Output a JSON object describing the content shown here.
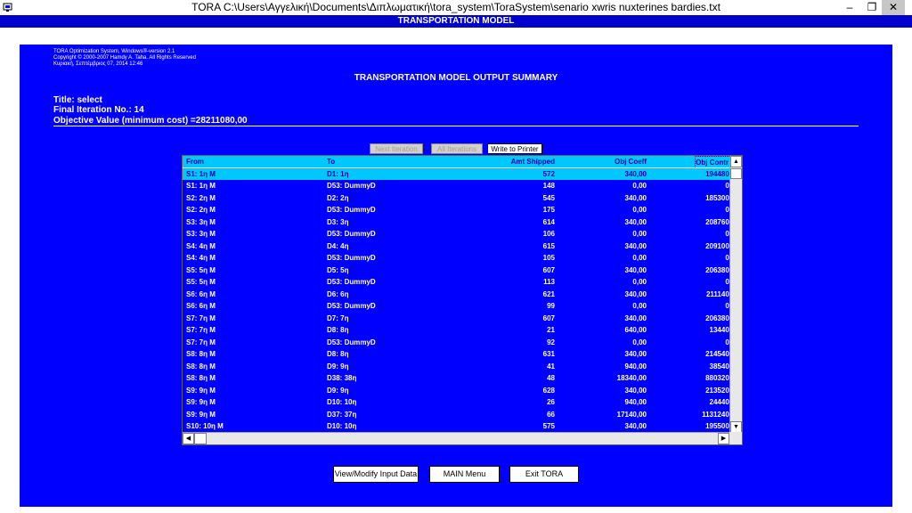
{
  "window": {
    "title": "TORA  C:\\Users\\Αγγελική\\Documents\\Διπλωματική\\tora_system\\ToraSystem\\senario xwris nuxterines bardies.txt",
    "min_glyph": "–",
    "max_glyph": "❐",
    "close_glyph": "✕"
  },
  "frame_caption": "TRANSPORTATION MODEL",
  "copyright": {
    "line1": "TORA Optimization System, Windows®-version 2.1",
    "line2": "Copyright © 2000-2007 Hamdy A. Taha.  All Rights Reserved",
    "line3": "Κυριακή, Σεπτέμβριος 07, 2014 12:46"
  },
  "summary": {
    "heading": "TRANSPORTATION MODEL OUTPUT SUMMARY",
    "title_line": "Title: select",
    "iteration_line": "Final Iteration No.:  14",
    "objective_line": "Objective Value (minimum cost) =28211080,00"
  },
  "toolbar": {
    "next_iteration": "Next Iteration",
    "all_iterations": "All Iterations",
    "write_to_printer": "Write to Printer"
  },
  "table": {
    "headers": {
      "from": "From",
      "to": "To",
      "amt": "Amt Shipped",
      "coeff": "Obj Coeff",
      "contr": "Obj Contr"
    },
    "rows": [
      {
        "from": "S1:  1η M",
        "to": "D1:  1η",
        "amt": "572",
        "coeff": "340,00",
        "contr": "194480,"
      },
      {
        "from": "S1:  1η M",
        "to": "D53:  DummyD",
        "amt": "148",
        "coeff": "0,00",
        "contr": "0,"
      },
      {
        "from": "S2:  2η M",
        "to": "D2:  2η",
        "amt": "545",
        "coeff": "340,00",
        "contr": "185300,"
      },
      {
        "from": "S2:  2η M",
        "to": "D53:  DummyD",
        "amt": "175",
        "coeff": "0,00",
        "contr": "0,"
      },
      {
        "from": "S3:  3η M",
        "to": "D3:  3η",
        "amt": "614",
        "coeff": "340,00",
        "contr": "208760,"
      },
      {
        "from": "S3:  3η M",
        "to": "D53:  DummyD",
        "amt": "106",
        "coeff": "0,00",
        "contr": "0,"
      },
      {
        "from": "S4:  4η M",
        "to": "D4:  4η",
        "amt": "615",
        "coeff": "340,00",
        "contr": "209100,"
      },
      {
        "from": "S4:  4η M",
        "to": "D53:  DummyD",
        "amt": "105",
        "coeff": "0,00",
        "contr": "0,"
      },
      {
        "from": "S5:  5η M",
        "to": "D5:  5η",
        "amt": "607",
        "coeff": "340,00",
        "contr": "206380,"
      },
      {
        "from": "S5:  5η M",
        "to": "D53:  DummyD",
        "amt": "113",
        "coeff": "0,00",
        "contr": "0,"
      },
      {
        "from": "S6:  6η M",
        "to": "D6:  6η",
        "amt": "621",
        "coeff": "340,00",
        "contr": "211140,"
      },
      {
        "from": "S6:  6η M",
        "to": "D53:  DummyD",
        "amt": "99",
        "coeff": "0,00",
        "contr": "0,"
      },
      {
        "from": "S7:  7η M",
        "to": "D7:  7η",
        "amt": "607",
        "coeff": "340,00",
        "contr": "206380,"
      },
      {
        "from": "S7:  7η M",
        "to": "D8:  8η",
        "amt": "21",
        "coeff": "640,00",
        "contr": "13440,"
      },
      {
        "from": "S7:  7η M",
        "to": "D53:  DummyD",
        "amt": "92",
        "coeff": "0,00",
        "contr": "0,"
      },
      {
        "from": "S8:  8η M",
        "to": "D8:  8η",
        "amt": "631",
        "coeff": "340,00",
        "contr": "214540,"
      },
      {
        "from": "S8:  8η M",
        "to": "D9:  9η",
        "amt": "41",
        "coeff": "940,00",
        "contr": "38540,"
      },
      {
        "from": "S8:  8η M",
        "to": "D38:  38η",
        "amt": "48",
        "coeff": "18340,00",
        "contr": "880320,"
      },
      {
        "from": "S9:  9η M",
        "to": "D9:  9η",
        "amt": "628",
        "coeff": "340,00",
        "contr": "213520,"
      },
      {
        "from": "S9:  9η M",
        "to": "D10:  10η",
        "amt": "26",
        "coeff": "940,00",
        "contr": "24440,"
      },
      {
        "from": "S9:  9η M",
        "to": "D37:  37η",
        "amt": "66",
        "coeff": "17140,00",
        "contr": "1131240,"
      },
      {
        "from": "S10:  10η M",
        "to": "D10:  10η",
        "amt": "575",
        "coeff": "340,00",
        "contr": "195500,"
      }
    ]
  },
  "buttons": {
    "view_modify": "View/Modify Input Data",
    "main_menu": "MAIN Menu",
    "exit": "Exit TORA"
  }
}
